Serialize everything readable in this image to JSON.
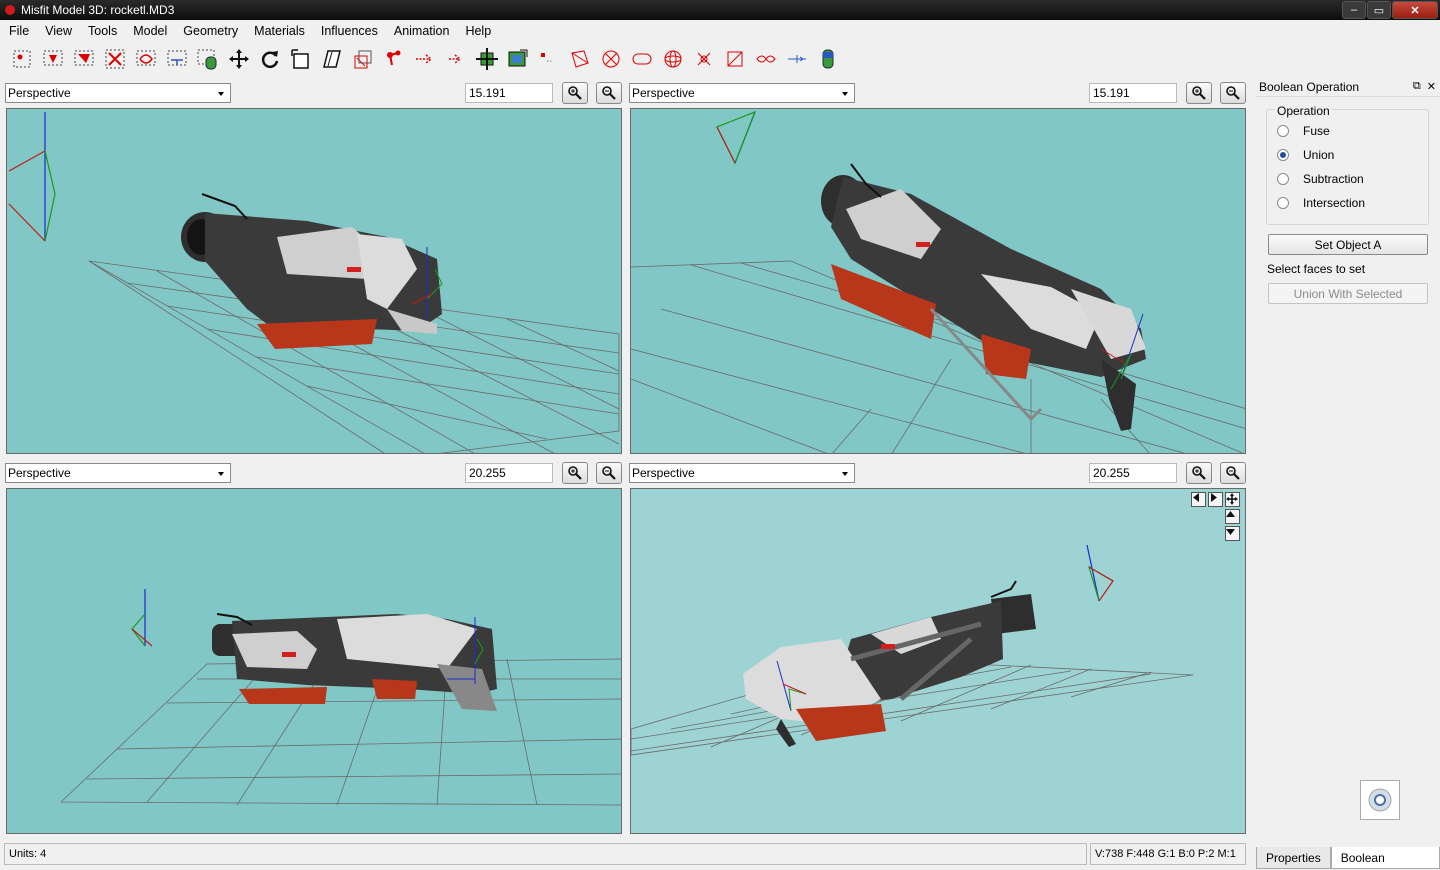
{
  "window": {
    "title": "Misfit Model 3D: rocketl.MD3",
    "min": "–",
    "max": "▭",
    "close": "✕"
  },
  "menu": [
    "File",
    "View",
    "Tools",
    "Model",
    "Geometry",
    "Materials",
    "Influences",
    "Animation",
    "Help"
  ],
  "toolbar": {
    "icons": [
      "select-vertices-icon",
      "select-faces-icon",
      "select-connected-icon",
      "select-groups-icon",
      "select-bone-joints-icon",
      "select-points-icon",
      "select-projections-icon",
      "move-icon",
      "rotate-icon",
      "scale-icon",
      "shear-icon",
      "attach-icon",
      "bone-joint-icon",
      "vertex-icon",
      "point-icon",
      "extrude-icon",
      "texture-projection-icon",
      "background-image-icon",
      "drag-vertex-icon",
      "cube-icon",
      "ellipsoid-icon",
      "cylinder-icon",
      "torus-icon",
      "polygon-icon",
      "rectangle-icon",
      "flip-icon",
      "align-icon",
      "cylinder-shape-icon"
    ]
  },
  "viewports": [
    {
      "projection": "Perspective",
      "zoom": "15.191"
    },
    {
      "projection": "Perspective",
      "zoom": "15.191"
    },
    {
      "projection": "Perspective",
      "zoom": "20.255"
    },
    {
      "projection": "Perspective",
      "zoom": "20.255"
    }
  ],
  "panel": {
    "title": "Boolean Operation",
    "group_title": "Operation",
    "options": [
      "Fuse",
      "Union",
      "Subtraction",
      "Intersection"
    ],
    "selected": "Union",
    "set_object_button": "Set Object A",
    "hint": "Select faces to set",
    "union_button": "Union With Selected"
  },
  "status": {
    "units": "Units: 4",
    "counts": "V:738 F:448 G:1 B:0 P:2 M:1"
  },
  "tabs": [
    "Properties",
    "Boolean Operation"
  ],
  "colors": {
    "viewport_bg": "#81c7c6",
    "viewport_bg_light": "#9dd4d3",
    "gun_dark": "#2e2e2e",
    "gun_white": "#d8d8d8",
    "gun_orange": "#b8361a"
  }
}
